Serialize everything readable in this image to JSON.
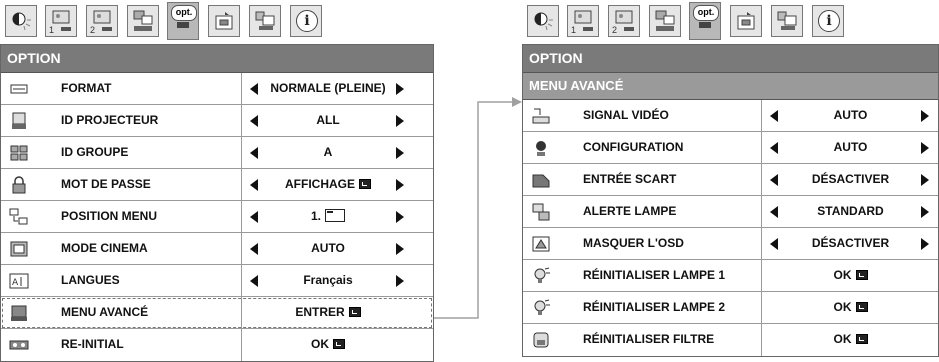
{
  "colors": {
    "title_bg": "#7a7a7a",
    "subtitle_bg": "#9a9a9a",
    "text": "#111111",
    "connector": "#a0a0a0"
  },
  "tabs": [
    {
      "name": "picture-tab",
      "icon": "sun-contrast-icon"
    },
    {
      "name": "image1-tab",
      "icon": "image-adjust-1-icon",
      "sub": "1"
    },
    {
      "name": "image2-tab",
      "icon": "image-adjust-2-icon",
      "sub": "2"
    },
    {
      "name": "signal-tab",
      "icon": "signal-icon"
    },
    {
      "name": "option-tab",
      "icon": "option-icon",
      "label": "opt."
    },
    {
      "name": "setting-tab",
      "icon": "setting-icon"
    },
    {
      "name": "network-tab",
      "icon": "network-icon"
    },
    {
      "name": "info-tab",
      "icon": "information-icon",
      "label": "i"
    }
  ],
  "left_menu": {
    "title": "OPTION",
    "rows": [
      {
        "label": "FORMAT",
        "value": "NORMALE (PLEINE)",
        "arrows": true,
        "icon": "format-icon"
      },
      {
        "label": "ID PROJECTEUR",
        "value": "ALL",
        "arrows": true,
        "icon": "projector-id-icon"
      },
      {
        "label": "ID GROUPE",
        "value": "A",
        "arrows": true,
        "icon": "group-id-icon"
      },
      {
        "label": "MOT DE PASSE",
        "value": "AFFICHAGE",
        "arrows": true,
        "enter": true,
        "icon": "padlock-icon"
      },
      {
        "label": "POSITION MENU",
        "value": "1.",
        "arrows": true,
        "menu_pos": true,
        "icon": "menu-position-icon"
      },
      {
        "label": "MODE CINEMA",
        "value": "AUTO",
        "arrows": true,
        "icon": "cinema-mode-icon"
      },
      {
        "label": "LANGUES",
        "value": "Français",
        "arrows": true,
        "icon": "language-icon"
      },
      {
        "label": "MENU AVANCÉ",
        "value": "ENTRER",
        "arrows": false,
        "enter": true,
        "icon": "advanced-menu-icon"
      },
      {
        "label": "RE-INITIAL",
        "value": "OK",
        "arrows": false,
        "enter": true,
        "icon": "reset-icon"
      }
    ]
  },
  "right_menu": {
    "title": "OPTION",
    "subtitle": "MENU AVANCÉ",
    "rows": [
      {
        "label": "SIGNAL VIDÉO",
        "value": "AUTO",
        "arrows": true,
        "icon": "video-signal-icon"
      },
      {
        "label": "CONFIGURATION",
        "value": "AUTO",
        "arrows": true,
        "icon": "configuration-icon"
      },
      {
        "label": "ENTRÉE SCART",
        "value": "DÉSACTIVER",
        "arrows": true,
        "icon": "scart-input-icon"
      },
      {
        "label": "ALERTE LAMPE",
        "value": "STANDARD",
        "arrows": true,
        "icon": "lamp-alert-icon"
      },
      {
        "label": "MASQUER L'OSD",
        "value": "DÉSACTIVER",
        "arrows": true,
        "icon": "osd-hide-icon"
      },
      {
        "label": "RÉINITIALISER LAMPE 1",
        "value": "OK",
        "arrows": false,
        "enter": true,
        "icon": "lamp-reset-icon"
      },
      {
        "label": "RÉINITIALISER LAMPE 2",
        "value": "OK",
        "arrows": false,
        "enter": true,
        "icon": "lamp-reset-icon"
      },
      {
        "label": "RÉINITIALISER FILTRE",
        "value": "OK",
        "arrows": false,
        "enter": true,
        "icon": "filter-reset-icon"
      }
    ]
  }
}
